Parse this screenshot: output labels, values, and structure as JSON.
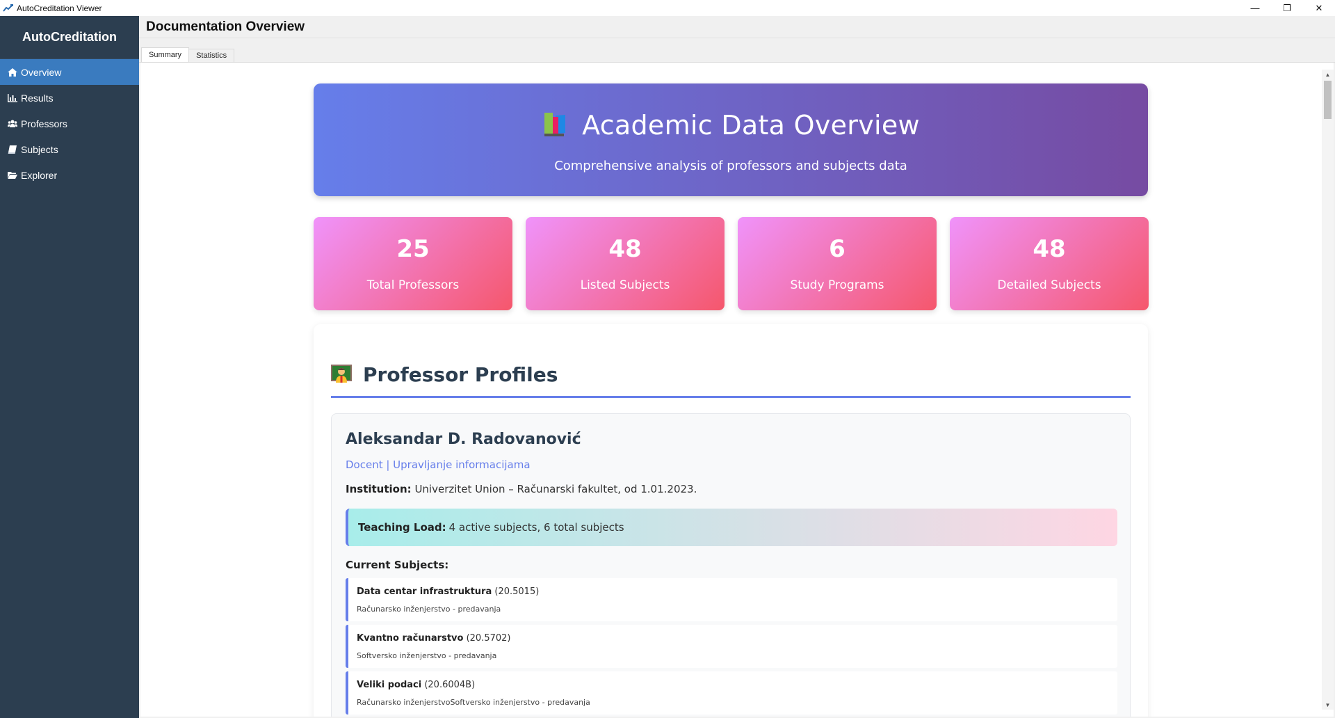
{
  "window": {
    "title": "AutoCreditation Viewer",
    "minimize": "—",
    "restore": "❐",
    "close": "✕"
  },
  "sidebar": {
    "brand": "AutoCreditation",
    "items": [
      {
        "label": "Overview",
        "icon": "home-icon",
        "active": true
      },
      {
        "label": "Results",
        "icon": "bar-chart-icon"
      },
      {
        "label": "Professors",
        "icon": "users-icon"
      },
      {
        "label": "Subjects",
        "icon": "book-icon"
      },
      {
        "label": "Explorer",
        "icon": "folder-open-icon"
      }
    ]
  },
  "header": {
    "title": "Documentation Overview"
  },
  "tabs": [
    {
      "label": "Summary",
      "active": true
    },
    {
      "label": "Statistics"
    }
  ],
  "hero": {
    "title": "Academic Data Overview",
    "subtitle": "Comprehensive analysis of professors and subjects data"
  },
  "stats": [
    {
      "value": "25",
      "label": "Total Professors"
    },
    {
      "value": "48",
      "label": "Listed Subjects"
    },
    {
      "value": "6",
      "label": "Study Programs"
    },
    {
      "value": "48",
      "label": "Detailed Subjects"
    }
  ],
  "section": {
    "title": "Professor Profiles",
    "profile": {
      "name": "Aleksandar D. Radovanović",
      "role": "Docent | Upravljanje informacijama",
      "institution_label": "Institution:",
      "institution": "Univerzitet Union – Računarski fakultet, od 1.01.2023.",
      "load_label": "Teaching Load:",
      "load": "4 active subjects, 6 total subjects",
      "current_label": "Current Subjects:",
      "subjects": [
        {
          "name": "Data centar infrastruktura",
          "code": "(20.5015)",
          "program": "Računarsko inženjerstvo - predavanja"
        },
        {
          "name": "Kvantno računarstvo",
          "code": "(20.5702)",
          "program": "Softversko inženjerstvo - predavanja"
        },
        {
          "name": "Veliki podaci",
          "code": "(20.6004B)",
          "program": "Računarsko inženjerstvoSoftversko inženjerstvo - predavanja"
        }
      ]
    }
  },
  "colors": {
    "sidebar": "#2c3e50",
    "active": "#3a7bbf",
    "hero_start": "#667eea",
    "hero_end": "#764ba2",
    "stat_start": "#f093fb",
    "stat_end": "#f5576c"
  }
}
